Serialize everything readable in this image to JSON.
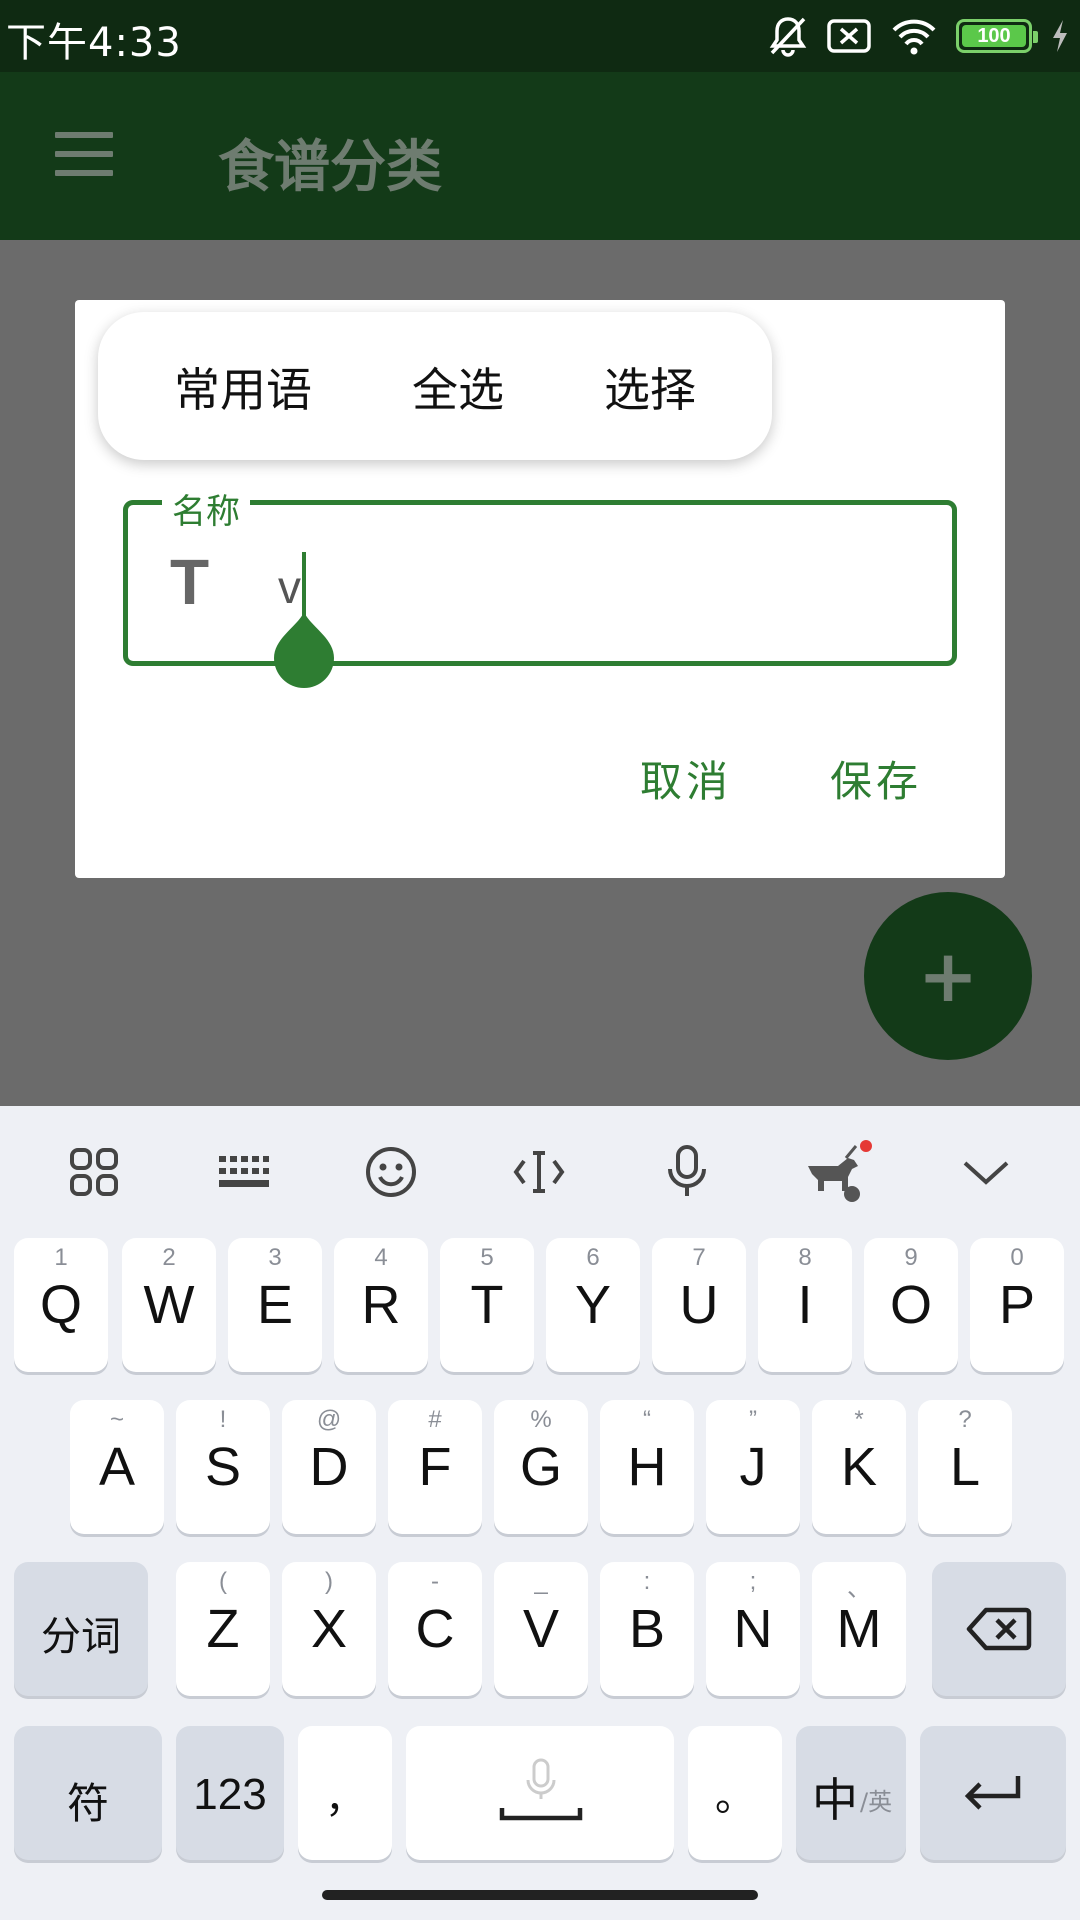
{
  "status_bar": {
    "time": "下午4:33",
    "battery": "100"
  },
  "app_bar": {
    "title": "食谱分类",
    "menu_icon": "hamburger-menu-icon"
  },
  "context_menu": {
    "items": [
      "常用语",
      "全选",
      "选择"
    ]
  },
  "dialog": {
    "field_label": "名称",
    "field_prefix": "T",
    "field_value": "v",
    "cancel_label": "取消",
    "save_label": "保存"
  },
  "fab": {
    "label": "+"
  },
  "keyboard": {
    "toolbar_icons": [
      "apps-grid-icon",
      "keyboard-icon",
      "emoji-icon",
      "text-cursor-icon",
      "microphone-icon",
      "guide-dog-icon",
      "collapse-chevron-icon"
    ],
    "row1": [
      {
        "main": "Q",
        "sub": "1"
      },
      {
        "main": "W",
        "sub": "2"
      },
      {
        "main": "E",
        "sub": "3"
      },
      {
        "main": "R",
        "sub": "4"
      },
      {
        "main": "T",
        "sub": "5"
      },
      {
        "main": "Y",
        "sub": "6"
      },
      {
        "main": "U",
        "sub": "7"
      },
      {
        "main": "I",
        "sub": "8"
      },
      {
        "main": "O",
        "sub": "9"
      },
      {
        "main": "P",
        "sub": "0"
      }
    ],
    "row2": [
      {
        "main": "A",
        "sub": "~"
      },
      {
        "main": "S",
        "sub": "!"
      },
      {
        "main": "D",
        "sub": "@"
      },
      {
        "main": "F",
        "sub": "#"
      },
      {
        "main": "G",
        "sub": "%"
      },
      {
        "main": "H",
        "sub": "“"
      },
      {
        "main": "J",
        "sub": "”"
      },
      {
        "main": "K",
        "sub": "*"
      },
      {
        "main": "L",
        "sub": "?"
      }
    ],
    "row3": [
      {
        "main": "Z",
        "sub": "("
      },
      {
        "main": "X",
        "sub": ")"
      },
      {
        "main": "C",
        "sub": "-"
      },
      {
        "main": "V",
        "sub": "_"
      },
      {
        "main": "B",
        "sub": ":"
      },
      {
        "main": "N",
        "sub": ";"
      },
      {
        "main": "M",
        "sub": "、"
      }
    ],
    "segment_label": "分词",
    "symbols_label": "符",
    "numbers_label": "123",
    "comma_label": "，",
    "period_label": "。",
    "lang_main": "中",
    "lang_sub": "/英"
  }
}
